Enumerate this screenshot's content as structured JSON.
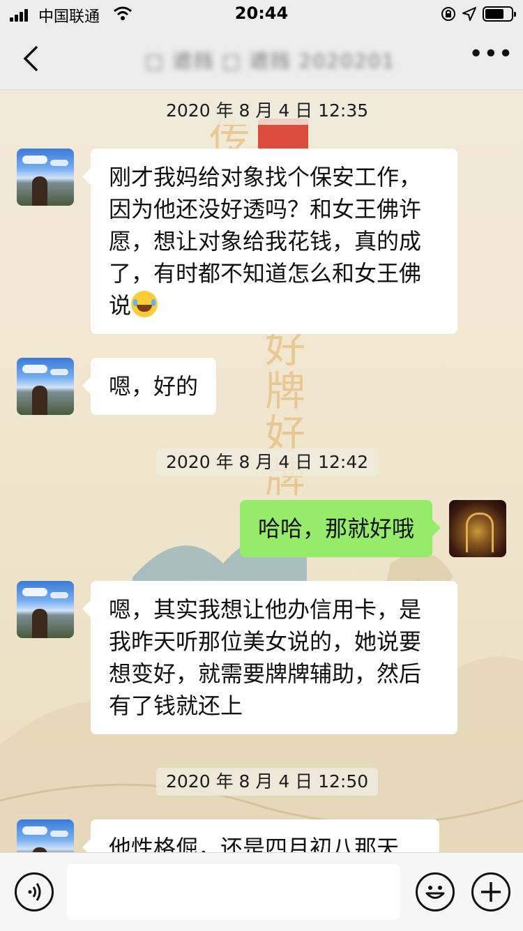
{
  "status_bar": {
    "carrier": "中国联通",
    "time": "20:44"
  },
  "nav": {
    "title": "□ 遮挡 □ 遮挡 2020201",
    "more": "•••"
  },
  "background": {
    "calligraphy_left": "传正能量",
    "calligraphy_right": "好牌好牌"
  },
  "messages": [
    {
      "type": "timestamp",
      "text": "2020 年 8 月 4 日 12:35"
    },
    {
      "type": "incoming",
      "text": "刚才我妈给对象找个保安工作，因为他还没好透吗？和女王佛许愿，想让对象给我花钱，真的成了，有时都不知道怎么和女王佛说",
      "emoji": "joy-tears"
    },
    {
      "type": "incoming",
      "text": "嗯，好的"
    },
    {
      "type": "timestamp",
      "text": "2020 年 8 月 4 日 12:42"
    },
    {
      "type": "outgoing",
      "text": "哈哈，那就好哦"
    },
    {
      "type": "incoming",
      "text": "嗯，其实我想让他办信用卡，是我昨天听那位美女说的，她说要想变好，就需要牌牌辅助，然后有了钱就还上"
    },
    {
      "type": "timestamp",
      "text": "2020 年 8 月 4 日 12:50"
    },
    {
      "type": "incoming",
      "text": "他性格倔，还是四月初八那天"
    }
  ],
  "colors": {
    "outgoing_bubble": "#95ec69",
    "incoming_bubble": "#ffffff",
    "bar_bg": "#ededed"
  },
  "icons": {
    "back": "chevron-left-icon",
    "voice": "voice-icon",
    "emoji": "emoji-icon",
    "plus": "plus-icon"
  }
}
